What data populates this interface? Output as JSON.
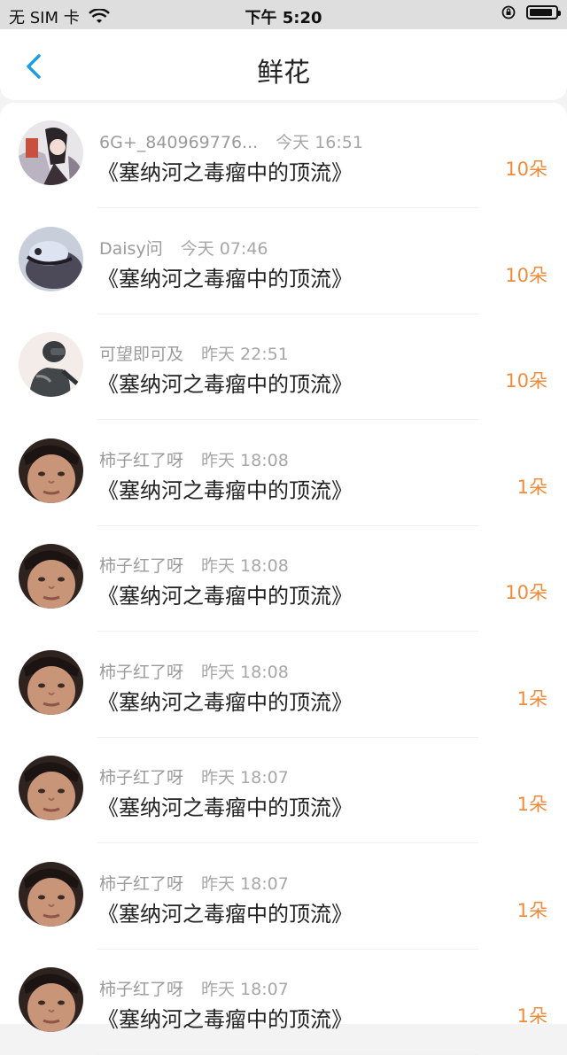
{
  "status": {
    "carrier": "无 SIM 卡",
    "time": "下午 5:20"
  },
  "nav": {
    "title": "鲜花"
  },
  "items": [
    {
      "name": "6G+_840969776...",
      "time": "今天 16:51",
      "title": "《塞纳河之毒瘤中的顶流》",
      "count": "10朵",
      "avatar": "anime-avatar"
    },
    {
      "name": "Daisy问",
      "time": "今天 07:46",
      "title": "《塞纳河之毒瘤中的顶流》",
      "count": "10朵",
      "avatar": "face-avatar"
    },
    {
      "name": "可望即可及",
      "time": "昨天 22:51",
      "title": "《塞纳河之毒瘤中的顶流》",
      "count": "10朵",
      "avatar": "soldier-avatar"
    },
    {
      "name": "柿子红了呀",
      "time": "昨天 18:08",
      "title": "《塞纳河之毒瘤中的顶流》",
      "count": "1朵",
      "avatar": "boy-avatar"
    },
    {
      "name": "柿子红了呀",
      "time": "昨天 18:08",
      "title": "《塞纳河之毒瘤中的顶流》",
      "count": "10朵",
      "avatar": "boy-avatar"
    },
    {
      "name": "柿子红了呀",
      "time": "昨天 18:08",
      "title": "《塞纳河之毒瘤中的顶流》",
      "count": "1朵",
      "avatar": "boy-avatar"
    },
    {
      "name": "柿子红了呀",
      "time": "昨天 18:07",
      "title": "《塞纳河之毒瘤中的顶流》",
      "count": "1朵",
      "avatar": "boy-avatar"
    },
    {
      "name": "柿子红了呀",
      "time": "昨天 18:07",
      "title": "《塞纳河之毒瘤中的顶流》",
      "count": "1朵",
      "avatar": "boy-avatar"
    },
    {
      "name": "柿子红了呀",
      "time": "昨天 18:07",
      "title": "《塞纳河之毒瘤中的顶流》",
      "count": "1朵",
      "avatar": "boy-avatar"
    }
  ],
  "colors": {
    "accent": "#1c9be6",
    "count": "#ef8b3b"
  }
}
